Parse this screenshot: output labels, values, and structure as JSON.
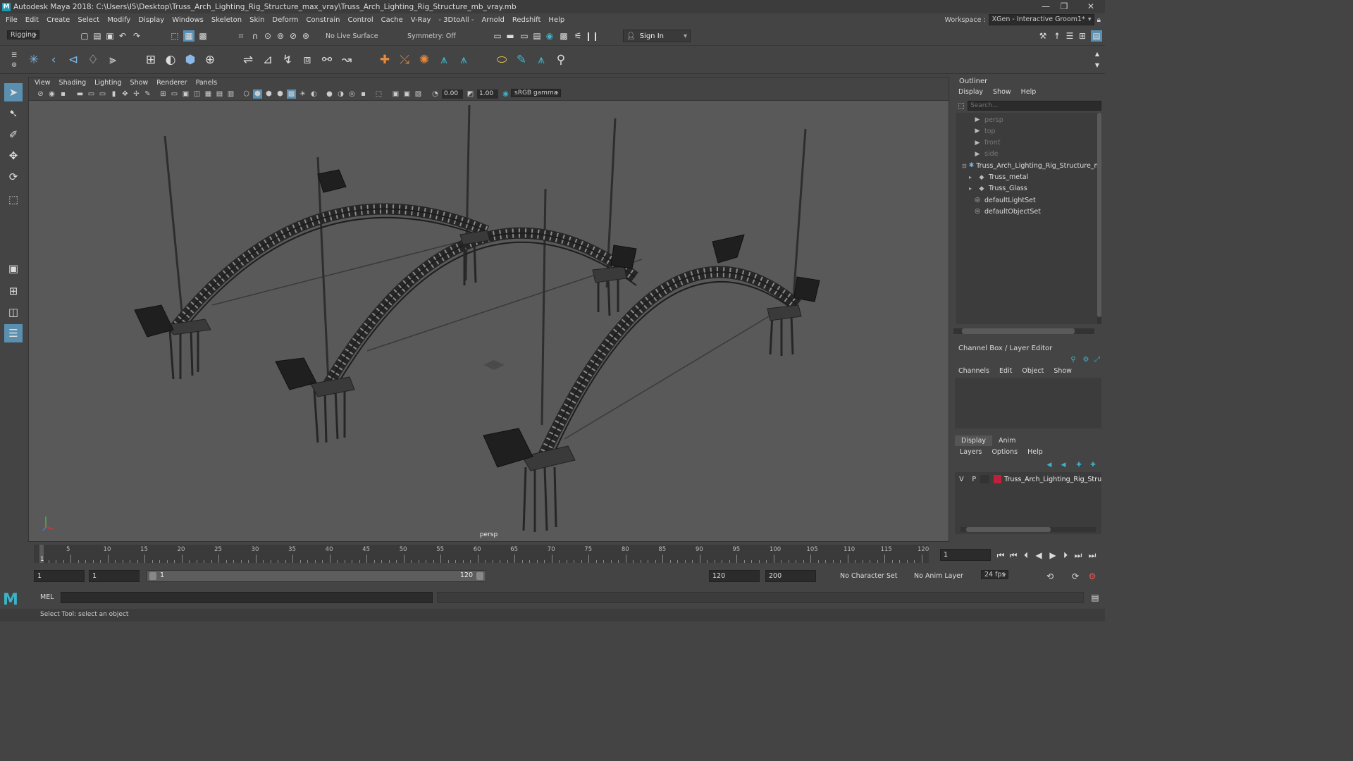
{
  "app": {
    "title": "Autodesk Maya 2018: C:\\Users\\I5\\Desktop\\Truss_Arch_Lighting_Rig_Structure_max_vray\\Truss_Arch_Lighting_Rig_Structure_mb_vray.mb"
  },
  "menus": [
    "File",
    "Edit",
    "Create",
    "Select",
    "Modify",
    "Display",
    "Windows",
    "Skeleton",
    "Skin",
    "Deform",
    "Constrain",
    "Control",
    "Cache",
    "V-Ray",
    "- 3DtoAll -",
    "Arnold",
    "Redshift",
    "Help"
  ],
  "workspace": {
    "label": "Workspace :",
    "value": "XGen - Interactive Groom1*"
  },
  "statusline": {
    "mode": "Rigging",
    "live_surface": "No Live Surface",
    "symmetry": "Symmetry: Off",
    "sign_in": "Sign In"
  },
  "viewport": {
    "menus": [
      "View",
      "Shading",
      "Lighting",
      "Show",
      "Renderer",
      "Panels"
    ],
    "exposure": "0.00",
    "gamma": "1.00",
    "color_space": "sRGB gamma",
    "camera": "persp"
  },
  "outliner": {
    "title": "Outliner",
    "menus": [
      "Display",
      "Show",
      "Help"
    ],
    "search_placeholder": "Search...",
    "items": [
      {
        "label": "persp",
        "type": "camera",
        "indent": 0,
        "dim": true
      },
      {
        "label": "top",
        "type": "camera",
        "indent": 0,
        "dim": true
      },
      {
        "label": "front",
        "type": "camera",
        "indent": 0,
        "dim": true
      },
      {
        "label": "side",
        "type": "camera",
        "indent": 0,
        "dim": true
      },
      {
        "label": "Truss_Arch_Lighting_Rig_Structure_nc",
        "type": "group",
        "indent": 0,
        "dim": false
      },
      {
        "label": "Truss_metal",
        "type": "mesh",
        "indent": 1,
        "dim": false
      },
      {
        "label": "Truss_Glass",
        "type": "mesh",
        "indent": 1,
        "dim": false
      },
      {
        "label": "defaultLightSet",
        "type": "set",
        "indent": 0,
        "dim": false
      },
      {
        "label": "defaultObjectSet",
        "type": "set",
        "indent": 0,
        "dim": false
      }
    ]
  },
  "channelbox": {
    "title": "Channel Box / Layer Editor",
    "menus": [
      "Channels",
      "Edit",
      "Object",
      "Show"
    ]
  },
  "layers": {
    "tabs": [
      "Display",
      "Anim"
    ],
    "menus": [
      "Layers",
      "Options",
      "Help"
    ],
    "row": {
      "v": "V",
      "p": "P",
      "name": "Truss_Arch_Lighting_Rig_Struct",
      "color": "#c0203a"
    }
  },
  "timeline": {
    "ticks": [
      "5",
      "10",
      "15",
      "20",
      "25",
      "30",
      "35",
      "40",
      "45",
      "50",
      "55",
      "60",
      "65",
      "70",
      "75",
      "80",
      "85",
      "90",
      "95",
      "100",
      "105",
      "110",
      "115",
      "120"
    ],
    "start_tick": "1",
    "current_frame": "1"
  },
  "range": {
    "start": "1",
    "playback_start": "1",
    "slider_start": "1",
    "slider_end": "120",
    "playback_end": "120",
    "end": "200",
    "character_set": "No Character Set",
    "anim_layer": "No Anim Layer",
    "fps": "24 fps"
  },
  "cmdline": {
    "lang": "MEL"
  },
  "helpline": {
    "text": "Select Tool: select an object"
  }
}
